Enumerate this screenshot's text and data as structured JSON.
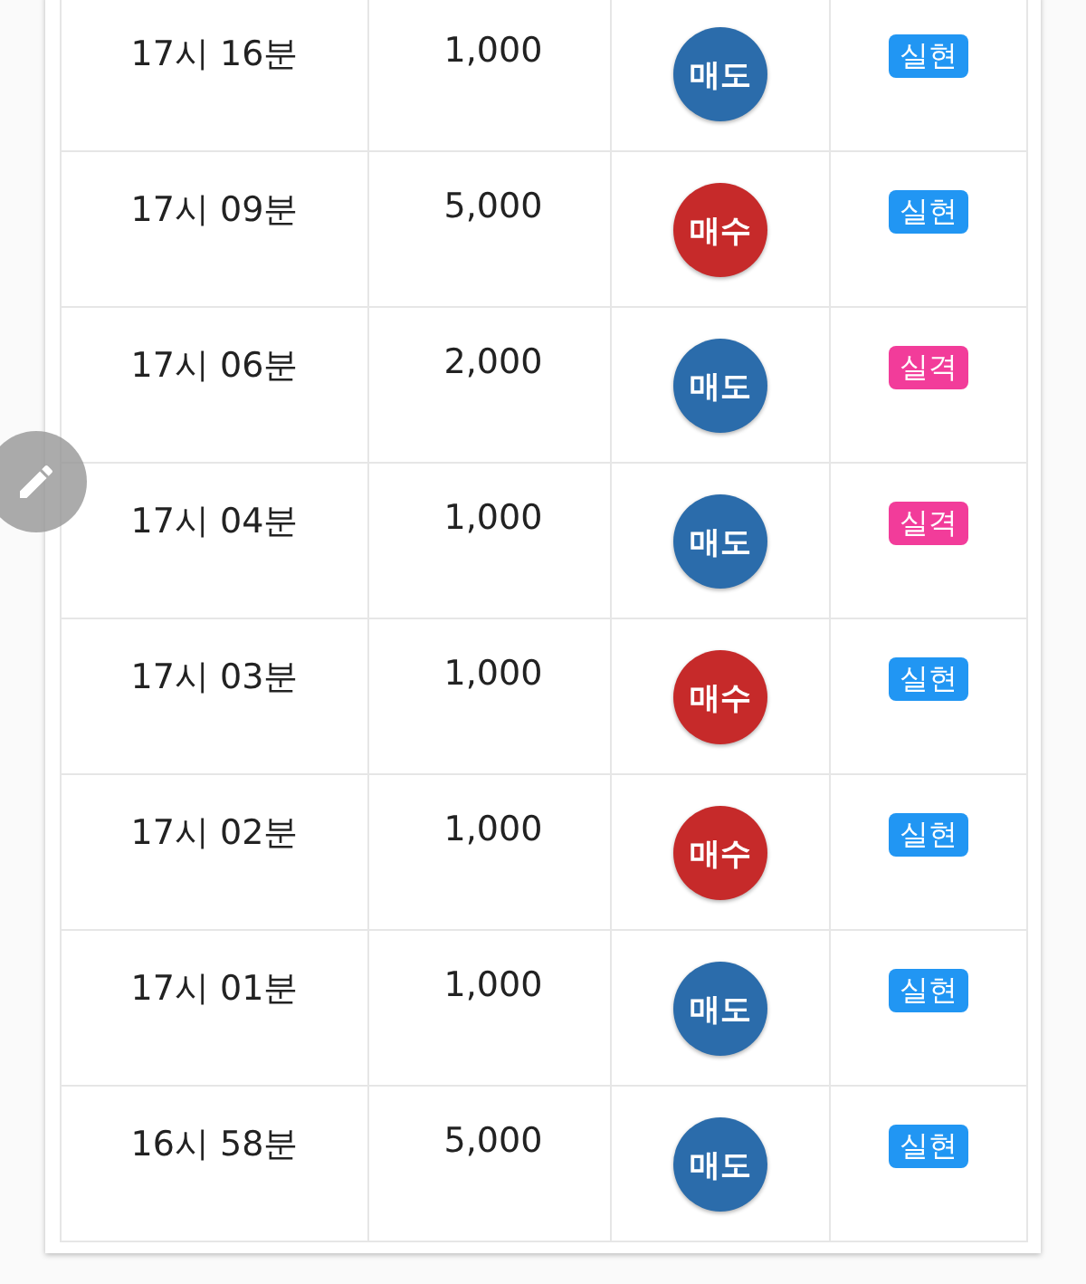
{
  "trades": [
    {
      "time": "17시 16분",
      "amount": "1,000",
      "order": {
        "label": "매도",
        "color": "#2b6cab"
      },
      "result": {
        "label": "실현",
        "color": "#2196f3"
      }
    },
    {
      "time": "17시 09분",
      "amount": "5,000",
      "order": {
        "label": "매수",
        "color": "#c62a2a"
      },
      "result": {
        "label": "실현",
        "color": "#2196f3"
      }
    },
    {
      "time": "17시 06분",
      "amount": "2,000",
      "order": {
        "label": "매도",
        "color": "#2b6cab"
      },
      "result": {
        "label": "실격",
        "color": "#f23c9a"
      }
    },
    {
      "time": "17시 04분",
      "amount": "1,000",
      "order": {
        "label": "매도",
        "color": "#2b6cab"
      },
      "result": {
        "label": "실격",
        "color": "#f23c9a"
      }
    },
    {
      "time": "17시 03분",
      "amount": "1,000",
      "order": {
        "label": "매수",
        "color": "#c62a2a"
      },
      "result": {
        "label": "실현",
        "color": "#2196f3"
      }
    },
    {
      "time": "17시 02분",
      "amount": "1,000",
      "order": {
        "label": "매수",
        "color": "#c62a2a"
      },
      "result": {
        "label": "실현",
        "color": "#2196f3"
      }
    },
    {
      "time": "17시 01분",
      "amount": "1,000",
      "order": {
        "label": "매도",
        "color": "#2b6cab"
      },
      "result": {
        "label": "실현",
        "color": "#2196f3"
      }
    },
    {
      "time": "16시 58분",
      "amount": "5,000",
      "order": {
        "label": "매도",
        "color": "#2b6cab"
      },
      "result": {
        "label": "실현",
        "color": "#2196f3"
      }
    }
  ]
}
